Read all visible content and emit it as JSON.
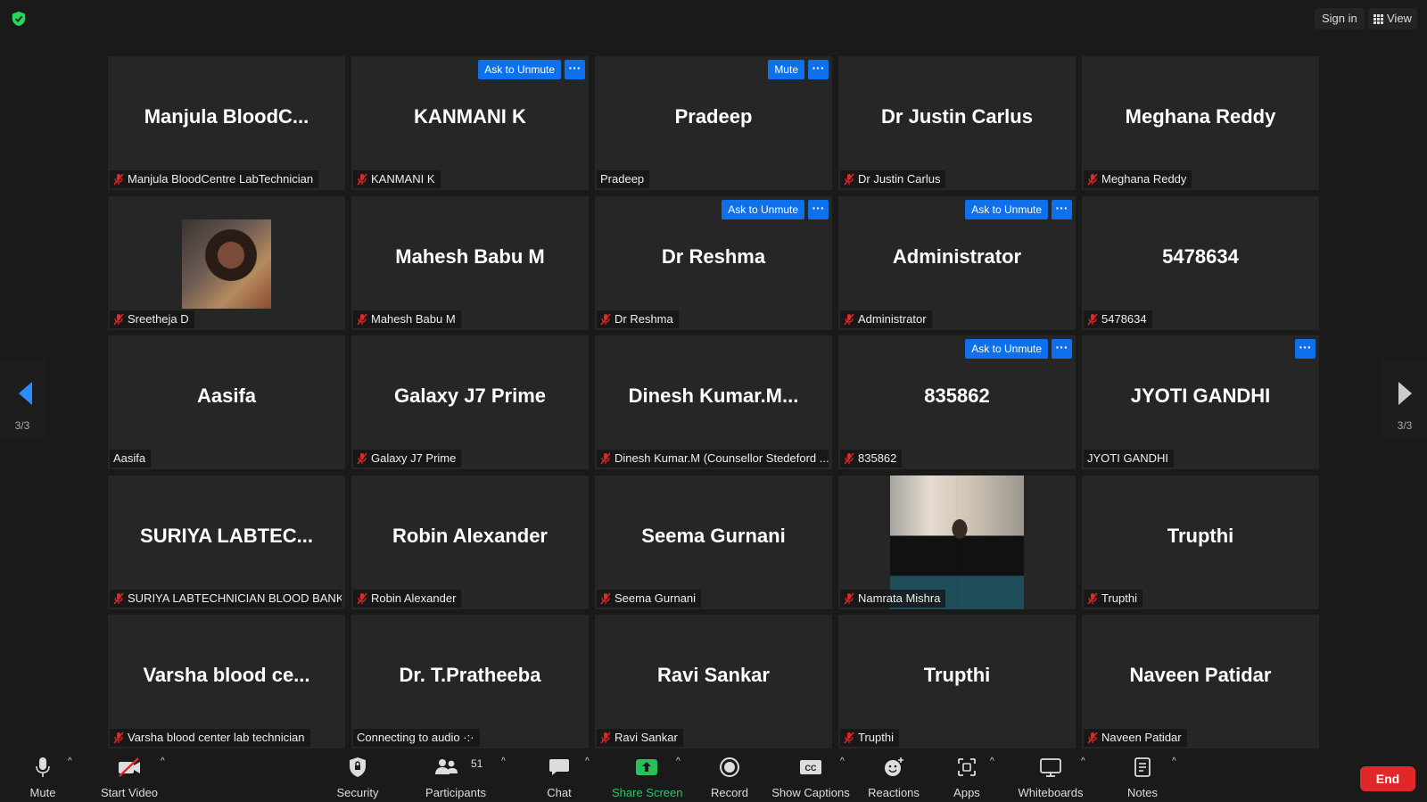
{
  "topbar": {
    "sign_in": "Sign in",
    "view": "View",
    "colors": {
      "shield": "#23d959"
    }
  },
  "tiles": [
    {
      "name": "Manjula  BloodC...",
      "label": "Manjula BloodCentre LabTechnician",
      "muted": true
    },
    {
      "name": "KANMANI K",
      "label": "KANMANI K",
      "muted": true,
      "action": "Ask to Unmute",
      "more": "···"
    },
    {
      "name": "Pradeep",
      "label": "Pradeep",
      "muted": false,
      "action": "Mute",
      "more": "···"
    },
    {
      "name": "Dr Justin Carlus",
      "label": "Dr Justin Carlus",
      "muted": true
    },
    {
      "name": "Meghana Reddy",
      "label": "Meghana Reddy",
      "muted": true
    },
    {
      "name": "",
      "label": "Sreetheja D",
      "muted": true,
      "photo": "sreetheja"
    },
    {
      "name": "Mahesh Babu M",
      "label": "Mahesh Babu M",
      "muted": true
    },
    {
      "name": "Dr Reshma",
      "label": "Dr Reshma",
      "muted": true,
      "action": "Ask to Unmute",
      "more": "···"
    },
    {
      "name": "Administrator",
      "label": "Administrator",
      "muted": true,
      "action": "Ask to Unmute",
      "more": "···"
    },
    {
      "name": "5478634",
      "label": "5478634",
      "muted": true
    },
    {
      "name": "Aasifa",
      "label": "Aasifa",
      "muted": false
    },
    {
      "name": "Galaxy J7 Prime",
      "label": "Galaxy J7 Prime",
      "muted": true
    },
    {
      "name": "Dinesh  Kumar.M...",
      "label": "Dinesh Kumar.M (Counsellor Stedeford ...",
      "muted": true
    },
    {
      "name": "835862",
      "label": "835862",
      "muted": true,
      "action": "Ask to Unmute",
      "more": "···"
    },
    {
      "name": "JYOTI GANDHI",
      "label": "JYOTI GANDHI",
      "muted": false,
      "more": "···"
    },
    {
      "name": "SURIYA  LABTEC...",
      "label": "SURIYA LABTECHNICIAN BLOOD BANK ...",
      "muted": true
    },
    {
      "name": "Robin Alexander",
      "label": "Robin Alexander",
      "muted": true
    },
    {
      "name": "Seema Gurnani",
      "label": "Seema Gurnani",
      "muted": true
    },
    {
      "name": "",
      "label": "Namrata Mishra",
      "muted": true,
      "photo": "namrata"
    },
    {
      "name": "Trupthi",
      "label": "Trupthi",
      "muted": true
    },
    {
      "name": "Varsha  blood  ce...",
      "label": "Varsha blood center lab technician",
      "muted": true
    },
    {
      "name": "Dr. T.Pratheeba",
      "label": "Connecting to audio ·:·",
      "muted": false
    },
    {
      "name": "Ravi Sankar",
      "label": "Ravi Sankar",
      "muted": true
    },
    {
      "name": "Trupthi",
      "label": "Trupthi",
      "muted": true
    },
    {
      "name": "Naveen Patidar",
      "label": "Naveen Patidar",
      "muted": true
    }
  ],
  "nav": {
    "page_left": "3/3",
    "page_right": "3/3",
    "colors": {
      "left_arrow": "#2d8cff",
      "right_arrow": "#cccccc"
    }
  },
  "toolbar": {
    "mute": "Mute",
    "start_video": "Start Video",
    "security": "Security",
    "participants": "Participants",
    "participants_count": "51",
    "chat": "Chat",
    "share_screen": "Share Screen",
    "record": "Record",
    "show_captions": "Show Captions",
    "reactions": "Reactions",
    "apps": "Apps",
    "whiteboards": "Whiteboards",
    "notes": "Notes",
    "end": "End",
    "caret": "^",
    "colors": {
      "share": "#23c35a",
      "end": "#e02828",
      "video_off": "#e02828"
    }
  }
}
